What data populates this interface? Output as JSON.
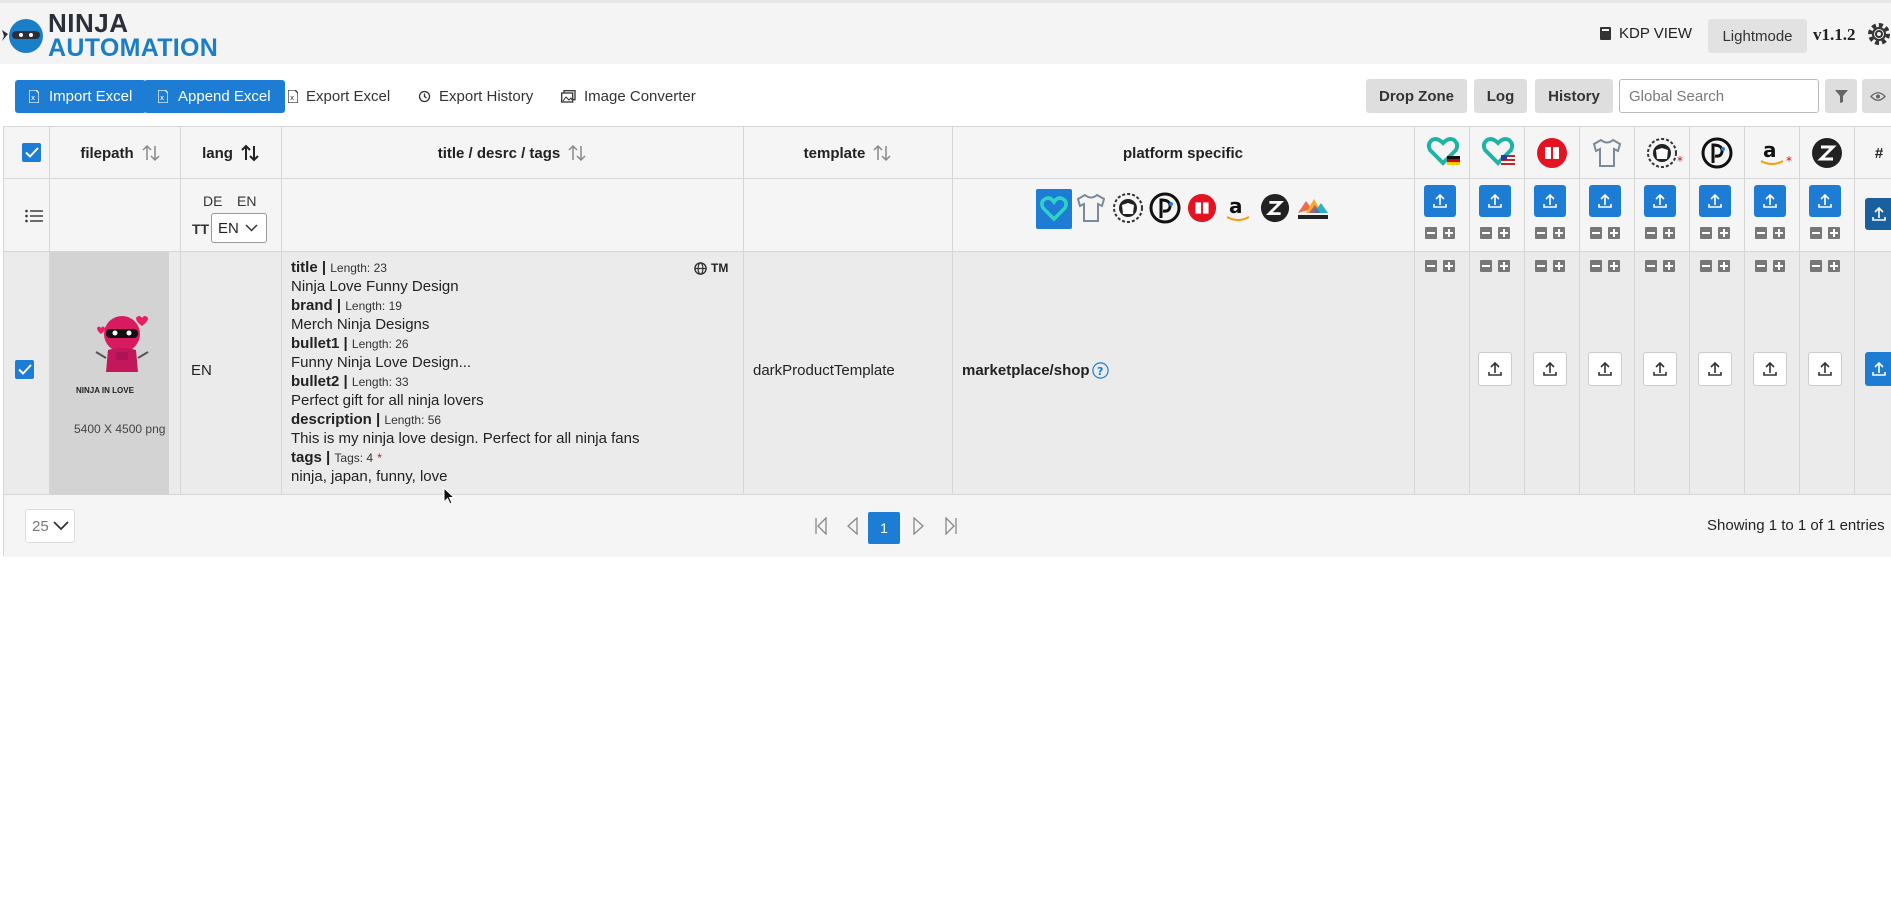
{
  "app": {
    "logo_line1": "NINJA",
    "logo_line2": "AUTOMATION",
    "kdp_view": "KDP VIEW",
    "theme_toggle": "Lightmode",
    "version": "v1.1.2"
  },
  "toolbar": {
    "import_excel": "Import Excel",
    "append_excel": "Append Excel",
    "export_excel": "Export Excel",
    "export_history": "Export History",
    "image_converter": "Image Converter",
    "drop_zone": "Drop Zone",
    "log": "Log",
    "history": "History",
    "search_placeholder": "Global Search"
  },
  "table": {
    "columns": {
      "filepath": "filepath",
      "lang": "lang",
      "title": "title / desrc / tags",
      "template": "template",
      "platform": "platform specific",
      "hash": "#"
    },
    "lang_filter": {
      "de": "DE",
      "en": "EN",
      "tt_label": "TT",
      "tt_value": "EN"
    },
    "platform_icons": [
      "spreadshirt-heart-icon",
      "tshirt-icon",
      "ninja-badge-icon",
      "displate-icon",
      "redbubble-icon",
      "amazon-icon",
      "zazzle-icon",
      "printful-icon"
    ],
    "marketplace_columns": [
      "spreadshirt-de-icon",
      "spreadshirt-us-icon",
      "redbubble-icon",
      "tshirt-icon",
      "ninja-badge-icon",
      "displate-icon",
      "amazon-icon",
      "zazzle-icon"
    ],
    "colors": {
      "accent": "#1d7cd4",
      "required": "#cc1111"
    },
    "row": {
      "image_caption": "NINJA IN LOVE",
      "image_size": "5400 X 4500 png",
      "lang": "EN",
      "title_label": "title |",
      "title_len": "Length: 23",
      "title": "Ninja Love Funny Design",
      "brand_label": "brand |",
      "brand_len": "Length: 19",
      "brand": "Merch Ninja Designs",
      "bullet1_label": "bullet1 |",
      "bullet1_len": "Length: 26",
      "bullet1": "Funny Ninja Love Design...",
      "bullet2_label": "bullet2 |",
      "bullet2_len": "Length: 33",
      "bullet2": "Perfect gift for all ninja lovers",
      "description_label": "description |",
      "description_len": "Length: 56",
      "description": "This is my ninja love design. Perfect for all ninja fans",
      "tags_label": "tags |",
      "tags_len": "Tags: 4",
      "tags_required": "*",
      "tags": "ninja, japan, funny, love",
      "tm": "TM",
      "template": "darkProductTemplate",
      "platform_specific": "marketplace/shop"
    }
  },
  "pagination": {
    "page_size": "25",
    "current_page": "1",
    "summary": "Showing 1 to 1 of 1 entries"
  }
}
